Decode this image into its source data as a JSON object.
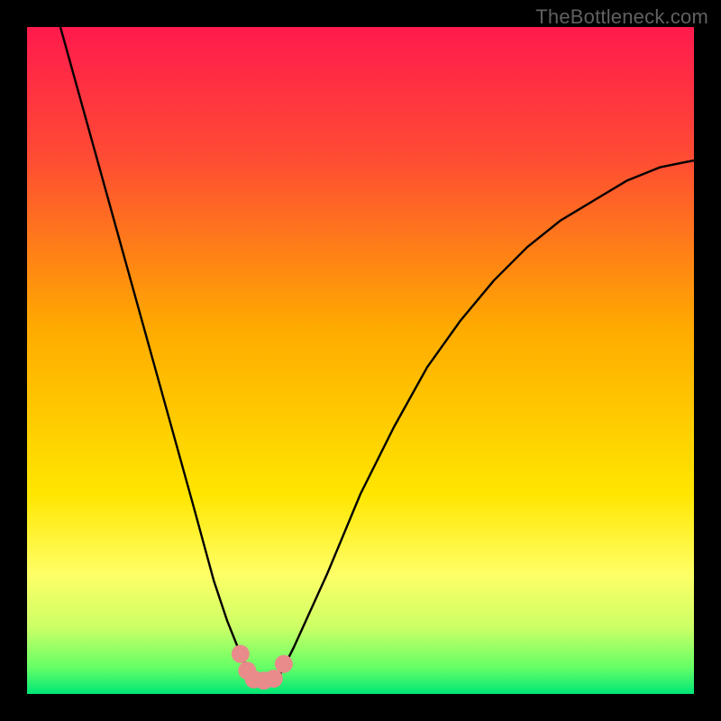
{
  "watermark": "TheBottleneck.com",
  "chart_data": {
    "type": "line",
    "title": "",
    "xlabel": "",
    "ylabel": "",
    "xlim": [
      0,
      100
    ],
    "ylim": [
      0,
      100
    ],
    "grid": false,
    "legend": null,
    "background_gradient": {
      "stops": [
        {
          "pos": 0.0,
          "color": "#ff1a4d"
        },
        {
          "pos": 0.2,
          "color": "#ff4d33"
        },
        {
          "pos": 0.45,
          "color": "#ffaa00"
        },
        {
          "pos": 0.7,
          "color": "#ffe600"
        },
        {
          "pos": 0.82,
          "color": "#ffff66"
        },
        {
          "pos": 0.9,
          "color": "#ccff66"
        },
        {
          "pos": 0.96,
          "color": "#66ff66"
        },
        {
          "pos": 1.0,
          "color": "#00e676"
        }
      ]
    },
    "series": [
      {
        "name": "bottleneck-curve",
        "color": "#000000",
        "width": 2.4,
        "x": [
          5,
          10,
          15,
          20,
          25,
          28,
          30,
          32,
          33.5,
          35,
          37,
          38,
          40,
          45,
          50,
          55,
          60,
          65,
          70,
          75,
          80,
          85,
          90,
          95,
          100
        ],
        "y": [
          100,
          82,
          64,
          46,
          28,
          17,
          11,
          6,
          3,
          2,
          2,
          3,
          7,
          18,
          30,
          40,
          49,
          56,
          62,
          67,
          71,
          74,
          77,
          79,
          80
        ]
      }
    ],
    "markers": [
      {
        "name": "marker-left-top",
        "x": 32.0,
        "y": 6.0,
        "color": "#e98b8b",
        "r": 10
      },
      {
        "name": "marker-left-mid",
        "x": 33.0,
        "y": 3.5,
        "color": "#e98b8b",
        "r": 10
      },
      {
        "name": "marker-bottom-1",
        "x": 34.0,
        "y": 2.2,
        "color": "#e98b8b",
        "r": 10
      },
      {
        "name": "marker-bottom-2",
        "x": 35.5,
        "y": 2.0,
        "color": "#e98b8b",
        "r": 10
      },
      {
        "name": "marker-bottom-3",
        "x": 37.0,
        "y": 2.3,
        "color": "#e98b8b",
        "r": 10
      },
      {
        "name": "marker-right",
        "x": 38.5,
        "y": 4.5,
        "color": "#e98b8b",
        "r": 10
      }
    ],
    "annotations": []
  }
}
